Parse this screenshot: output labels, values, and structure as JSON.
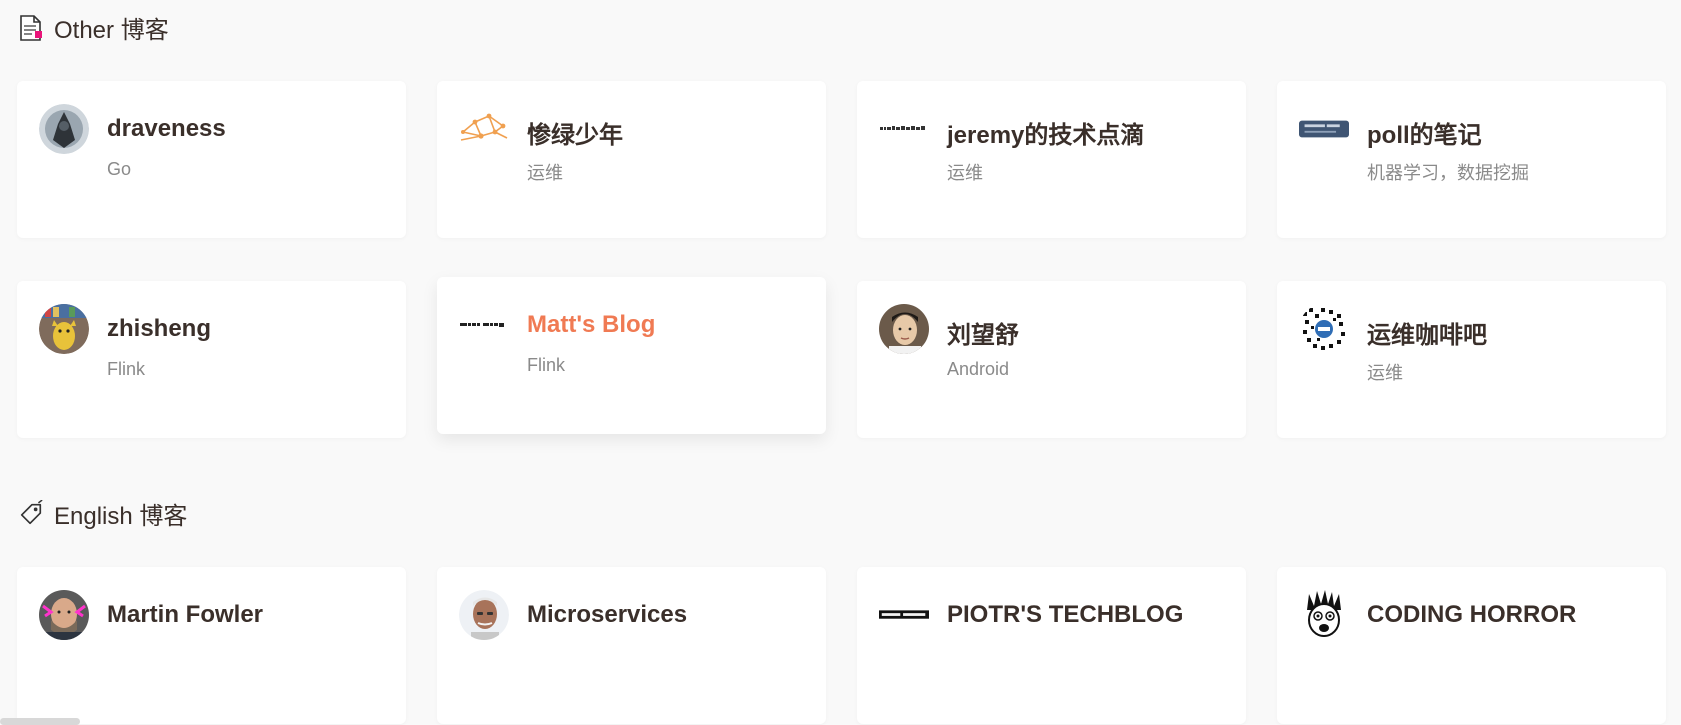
{
  "sections": [
    {
      "title": "Other 博客",
      "icon": "document-icon",
      "cards": [
        {
          "title": "draveness",
          "desc": "Go",
          "avatar": "draveness-avatar"
        },
        {
          "title": "惨绿少年",
          "desc": "运维",
          "avatar": "network-logo-avatar"
        },
        {
          "title": "jeremy的技术点滴",
          "desc": "运维",
          "avatar": "jeremy-text-logo"
        },
        {
          "title": "poll的笔记",
          "desc": "机器学习，数据挖掘",
          "avatar": "poll-banner-logo"
        },
        {
          "title": "zhisheng",
          "desc": "Flink",
          "avatar": "zhisheng-avatar"
        },
        {
          "title": "Matt's Blog",
          "desc": "Flink",
          "avatar": "matts-blog-text-logo",
          "hovered": true
        },
        {
          "title": "刘望舒",
          "desc": "Android",
          "avatar": "liuwangshu-avatar"
        },
        {
          "title": "运维咖啡吧",
          "desc": "运维",
          "avatar": "qr-code-avatar"
        }
      ]
    },
    {
      "title": "English 博客",
      "icon": "tag-icon",
      "cards": [
        {
          "title": "Martin Fowler",
          "desc": "",
          "avatar": "martin-fowler-avatar"
        },
        {
          "title": "Microservices",
          "desc": "",
          "avatar": "microservices-avatar"
        },
        {
          "title": "PIOTR'S TECHBLOG",
          "desc": "",
          "avatar": "piotr-banner-logo"
        },
        {
          "title": "CODING HORROR",
          "desc": "",
          "avatar": "coding-horror-avatar"
        }
      ]
    }
  ],
  "colors": {
    "background": "#f9f9f9",
    "card": "#ffffff",
    "title": "#3a2f2a",
    "desc": "#8a8a8a",
    "accent": "#f07a53"
  }
}
